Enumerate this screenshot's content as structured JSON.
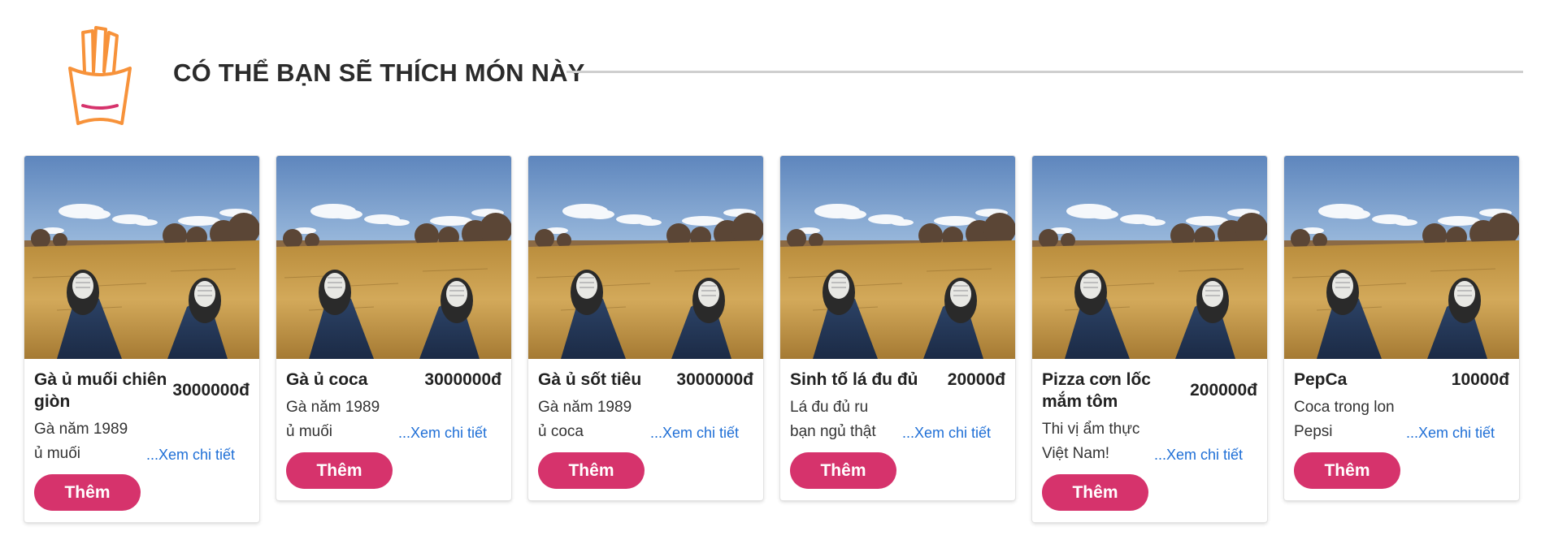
{
  "section": {
    "title": "CÓ THỂ BẠN SẼ THÍCH MÓN NÀY",
    "icon": "french-fries-icon"
  },
  "colors": {
    "accent": "#d6336c",
    "icon_orange": "#f7923a",
    "link": "#1f6fd6",
    "rule": "#cfcfcf"
  },
  "products": [
    {
      "name": "Gà ủ muối chiên giòn",
      "price": "3000000đ",
      "desc_line1": "Gà năm 1989",
      "desc_line2": "ủ muối",
      "detail_label": "...Xem chi tiết",
      "add_label": "Thêm"
    },
    {
      "name": "Gà ủ coca",
      "price": "3000000đ",
      "desc_line1": "Gà năm 1989",
      "desc_line2": "ủ muối",
      "detail_label": "...Xem chi tiết",
      "add_label": "Thêm"
    },
    {
      "name": "Gà ủ sốt tiêu",
      "price": "3000000đ",
      "desc_line1": "Gà năm 1989",
      "desc_line2": "ủ coca",
      "detail_label": "...Xem chi tiết",
      "add_label": "Thêm"
    },
    {
      "name": "Sinh tố lá đu đủ",
      "price": "20000đ",
      "desc_line1": "Lá đu đủ ru",
      "desc_line2": "bạn ngủ thật",
      "detail_label": "...Xem chi tiết",
      "add_label": "Thêm"
    },
    {
      "name": "Pizza cơn lốc mắm tôm",
      "price": "200000đ",
      "desc_line1": "Thi vị ẩm thực",
      "desc_line2": "Việt Nam!",
      "detail_label": "...Xem chi tiết",
      "add_label": "Thêm"
    },
    {
      "name": "PepCa",
      "price": "10000đ",
      "desc_line1": "Coca trong lon",
      "desc_line2": "Pepsi",
      "detail_label": "...Xem chi tiết",
      "add_label": "Thêm"
    }
  ]
}
